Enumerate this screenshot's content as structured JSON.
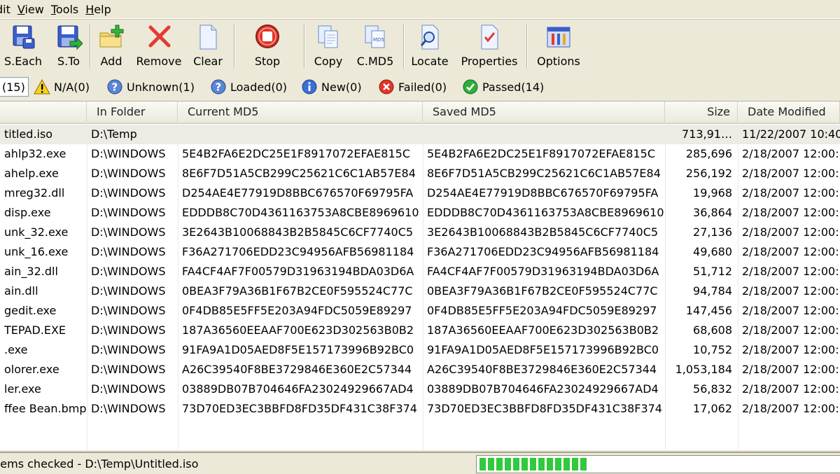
{
  "menu": [
    {
      "label": "Edit",
      "display": "dit",
      "ul": "E"
    },
    {
      "label": "View",
      "ul": "V"
    },
    {
      "label": "Tools",
      "ul": "T"
    },
    {
      "label": "Help",
      "ul": "H"
    }
  ],
  "toolbar": {
    "save_each": "S.Each",
    "save_to": "S.To",
    "add": "Add",
    "remove": "Remove",
    "clear": "Clear",
    "stop": "Stop",
    "copy": "Copy",
    "copy_md5": "C.MD5",
    "locate": "Locate",
    "properties": "Properties",
    "options": "Options"
  },
  "filters": {
    "all": "(15)",
    "na": "N/A(0)",
    "unknown": "Unknown(1)",
    "loaded": "Loaded(0)",
    "new": "New(0)",
    "failed": "Failed(0)",
    "passed": "Passed(14)"
  },
  "table": {
    "columns": {
      "in_folder": "In Folder",
      "current_md5": "Current MD5",
      "saved_md5": "Saved MD5",
      "size": "Size",
      "date_modified": "Date Modified"
    },
    "rows": [
      {
        "name": "titled.iso",
        "folder": "D:\\Temp",
        "current": "",
        "saved": "",
        "size": "713,91…",
        "date": "11/22/2007 10:40"
      },
      {
        "name": "ahlp32.exe",
        "folder": "D:\\WINDOWS",
        "current": "5E4B2FA6E2DC25E1F8917072EFAE815C",
        "saved": "5E4B2FA6E2DC25E1F8917072EFAE815C",
        "size": "285,696",
        "date": "2/18/2007 12:00:"
      },
      {
        "name": "ahelp.exe",
        "folder": "D:\\WINDOWS",
        "current": "8E6F7D51A5CB299C25621C6C1AB57E84",
        "saved": "8E6F7D51A5CB299C25621C6C1AB57E84",
        "size": "256,192",
        "date": "2/18/2007 12:00:"
      },
      {
        "name": "mreg32.dll",
        "folder": "D:\\WINDOWS",
        "current": "D254AE4E77919D8BBC676570F69795FA",
        "saved": "D254AE4E77919D8BBC676570F69795FA",
        "size": "19,968",
        "date": "2/18/2007 12:00:"
      },
      {
        "name": "disp.exe",
        "folder": "D:\\WINDOWS",
        "current": "EDDDB8C70D4361163753A8CBE8969610",
        "saved": "EDDDB8C70D4361163753A8CBE8969610",
        "size": "36,864",
        "date": "2/18/2007 12:00:"
      },
      {
        "name": "unk_32.exe",
        "folder": "D:\\WINDOWS",
        "current": "3E2643B10068843B2B5845C6CF7740C5",
        "saved": "3E2643B10068843B2B5845C6CF7740C5",
        "size": "27,136",
        "date": "2/18/2007 12:00:"
      },
      {
        "name": "unk_16.exe",
        "folder": "D:\\WINDOWS",
        "current": "F36A271706EDD23C94956AFB56981184",
        "saved": "F36A271706EDD23C94956AFB56981184",
        "size": "49,680",
        "date": "2/18/2007 12:00:"
      },
      {
        "name": "ain_32.dll",
        "folder": "D:\\WINDOWS",
        "current": "FA4CF4AF7F00579D31963194BDA03D6A",
        "saved": "FA4CF4AF7F00579D31963194BDA03D6A",
        "size": "51,712",
        "date": "2/18/2007 12:00:"
      },
      {
        "name": "ain.dll",
        "folder": "D:\\WINDOWS",
        "current": "0BEA3F79A36B1F67B2CE0F595524C77C",
        "saved": "0BEA3F79A36B1F67B2CE0F595524C77C",
        "size": "94,784",
        "date": "2/18/2007 12:00:"
      },
      {
        "name": "gedit.exe",
        "folder": "D:\\WINDOWS",
        "current": "0F4DB85E5FF5E203A94FDC5059E89297",
        "saved": "0F4DB85E5FF5E203A94FDC5059E89297",
        "size": "147,456",
        "date": "2/18/2007 12:00:"
      },
      {
        "name": "TEPAD.EXE",
        "folder": "D:\\WINDOWS",
        "current": "187A36560EEAAF700E623D302563B0B2",
        "saved": "187A36560EEAAF700E623D302563B0B2",
        "size": "68,608",
        "date": "2/18/2007 12:00:"
      },
      {
        "name": ".exe",
        "folder": "D:\\WINDOWS",
        "current": "91FA9A1D05AED8F5E157173996B92BC0",
        "saved": "91FA9A1D05AED8F5E157173996B92BC0",
        "size": "10,752",
        "date": "2/18/2007 12:00:"
      },
      {
        "name": "olorer.exe",
        "folder": "D:\\WINDOWS",
        "current": "A26C39540F8BE3729846E360E2C57344",
        "saved": "A26C39540F8BE3729846E360E2C57344",
        "size": "1,053,184",
        "date": "2/18/2007 12:00:"
      },
      {
        "name": "ler.exe",
        "folder": "D:\\WINDOWS",
        "current": "03889DB07B704646FA23024929667AD4",
        "saved": "03889DB07B704646FA23024929667AD4",
        "size": "56,832",
        "date": "2/18/2007 12:00:"
      },
      {
        "name": "ffee Bean.bmp",
        "folder": "D:\\WINDOWS",
        "current": "73D70ED3EC3BBFD8FD35DF431C38F374",
        "saved": "73D70ED3EC3BBFD8FD35DF431C38F374",
        "size": "17,062",
        "date": "2/18/2007 12:00:"
      }
    ]
  },
  "status": {
    "text": "tems checked - D:\\Temp\\Untitled.iso",
    "progress_percent": 30
  },
  "colors": {
    "progress": "#31c93d",
    "selected_row": "#ecebe4"
  }
}
